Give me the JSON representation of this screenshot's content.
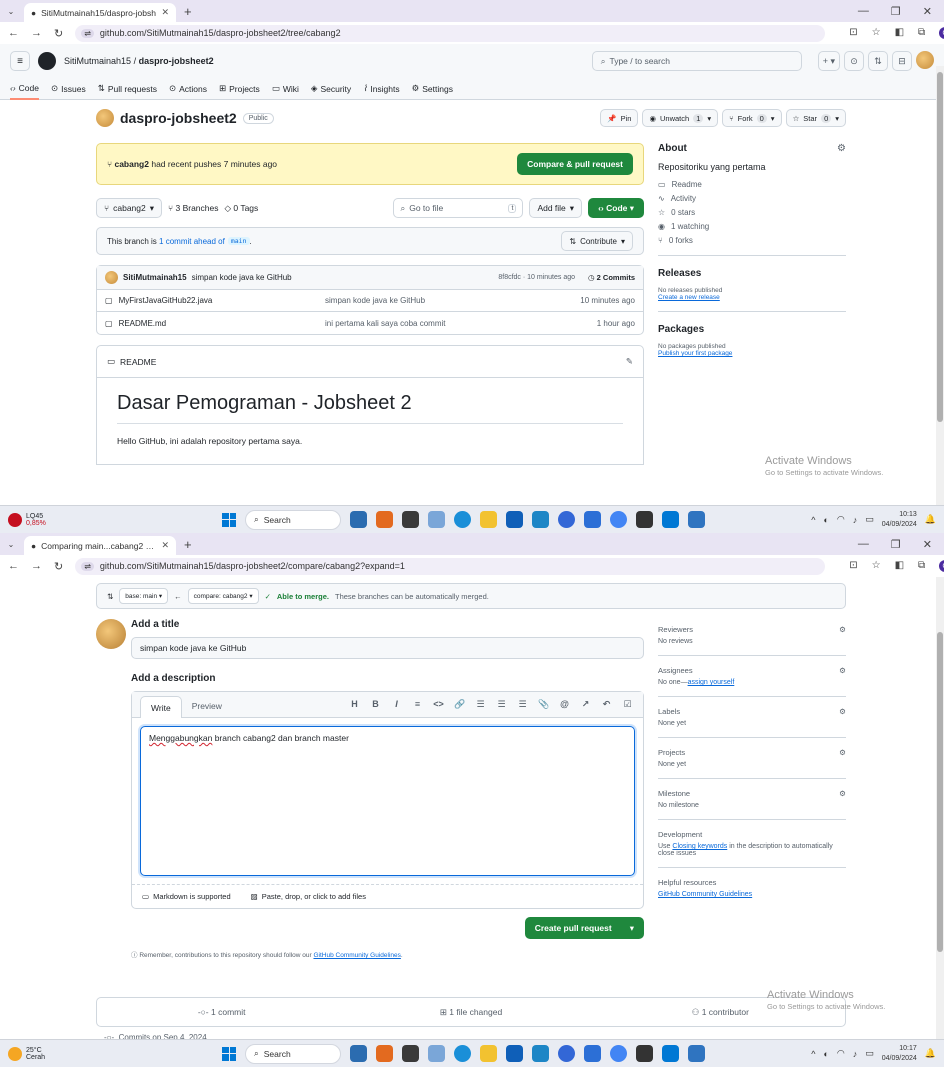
{
  "shot1": {
    "browser": {
      "tab_title": "SitiMutmainah15/daspro-jobsh",
      "url": "github.com/SitiMutmainah15/daspro-jobsheet2/tree/cabang2"
    },
    "header": {
      "owner": "SitiMutmainah15",
      "separator": "/",
      "repo": "daspro-jobsheet2",
      "search_placeholder": "Type / to search"
    },
    "repo_nav": [
      "Code",
      "Issues",
      "Pull requests",
      "Actions",
      "Projects",
      "Wiki",
      "Security",
      "Insights",
      "Settings"
    ],
    "repo_title": "daspro-jobsheet2",
    "visibility": "Public",
    "actions": {
      "pin": "Pin",
      "unwatch": "Unwatch",
      "unwatch_count": "1",
      "fork": "Fork",
      "fork_count": "0",
      "star": "Star",
      "star_count": "0"
    },
    "push_banner": {
      "branch": "cabang2",
      "text": "had recent pushes 7 minutes ago",
      "button": "Compare & pull request"
    },
    "branch_bar": {
      "branch": "cabang2",
      "branches": "3 Branches",
      "tags": "0 Tags",
      "goto_placeholder": "Go to file",
      "goto_kbd": "t",
      "add_file": "Add file",
      "code": "Code"
    },
    "ahead": {
      "prefix": "This branch is",
      "link": "1 commit ahead of",
      "base": "main",
      "suffix": ".",
      "contribute": "Contribute"
    },
    "commit": {
      "author": "SitiMutmainah15",
      "message": "simpan kode java ke GitHub",
      "meta": "8f8cfdc · 10 minutes ago",
      "count": "2 Commits"
    },
    "files": [
      {
        "name": "MyFirstJavaGitHub22.java",
        "msg": "simpan kode java ke GitHub",
        "time": "10 minutes ago"
      },
      {
        "name": "README.md",
        "msg": "ini pertama kali saya coba commit",
        "time": "1 hour ago"
      }
    ],
    "readme": {
      "label": "README",
      "heading": "Dasar Pemograman - Jobsheet 2",
      "body": "Hello GitHub, ini adalah repository pertama saya."
    },
    "about": {
      "title": "About",
      "description": "Repositoriku yang pertama",
      "items": [
        "Readme",
        "Activity",
        "0 stars",
        "1 watching",
        "0 forks"
      ]
    },
    "releases": {
      "title": "Releases",
      "none": "No releases published",
      "link": "Create a new release"
    },
    "packages": {
      "title": "Packages",
      "none": "No packages published",
      "link": "Publish your first package"
    },
    "watermark": {
      "title": "Activate Windows",
      "sub": "Go to Settings to activate Windows."
    },
    "taskbar": {
      "weather_top": "LQ45",
      "weather_bottom": "0,85%",
      "search": "Search",
      "time": "10:13",
      "date": "04/09/2024"
    }
  },
  "shot2": {
    "browser": {
      "tab_title": "Comparing main...cabang2 · Siti",
      "url": "github.com/SitiMutmainah15/daspro-jobsheet2/compare/cabang2?expand=1"
    },
    "merge_bar": {
      "base": "base: main",
      "compare": "compare: cabang2",
      "able": "Able to merge.",
      "desc": "These branches can be automatically merged."
    },
    "form": {
      "title_label": "Add a title",
      "title_value": "simpan kode java ke GitHub",
      "desc_label": "Add a description",
      "write_tab": "Write",
      "preview_tab": "Preview",
      "tools": [
        "H",
        "B",
        "I",
        "≡",
        "<>",
        "🔗",
        "☰",
        "☰",
        "☰",
        "📎",
        "@",
        "↗",
        "↶",
        "☑"
      ],
      "body_word1": "Menggabungkan",
      "body_rest": " branch cabang2 dan branch master",
      "markdown": "Markdown is supported",
      "paste": "Paste, drop, or click to add files",
      "create": "Create pull request",
      "remember": "Remember, contributions to this repository should follow our",
      "guidelines": "GitHub Community Guidelines",
      "period": "."
    },
    "sidebar": {
      "reviewers": {
        "label": "Reviewers",
        "value": "No reviews"
      },
      "assignees": {
        "label": "Assignees",
        "value": "No one—",
        "link": "assign yourself"
      },
      "labels": {
        "label": "Labels",
        "value": "None yet"
      },
      "projects": {
        "label": "Projects",
        "value": "None yet"
      },
      "milestone": {
        "label": "Milestone",
        "value": "No milestone"
      },
      "development": {
        "label": "Development",
        "pre": "Use ",
        "link": "Closing keywords",
        "post": " in the description to automatically close issues"
      },
      "helpful": {
        "label": "Helpful resources",
        "link": "GitHub Community Guidelines"
      }
    },
    "summary": {
      "commits": "1 commit",
      "files": "1 file changed",
      "contributors": "1 contributor"
    },
    "commits_on": "Commits on Sep 4, 2024",
    "watermark": {
      "title": "Activate Windows",
      "sub": "Go to Settings to activate Windows."
    },
    "taskbar": {
      "weather_top": "25°C",
      "weather_bottom": "Cerah",
      "search": "Search",
      "time": "10:17",
      "date": "04/09/2024"
    }
  },
  "colors": {
    "green": "#1f883d",
    "link": "#0969da",
    "banner": "#fff8c5"
  }
}
